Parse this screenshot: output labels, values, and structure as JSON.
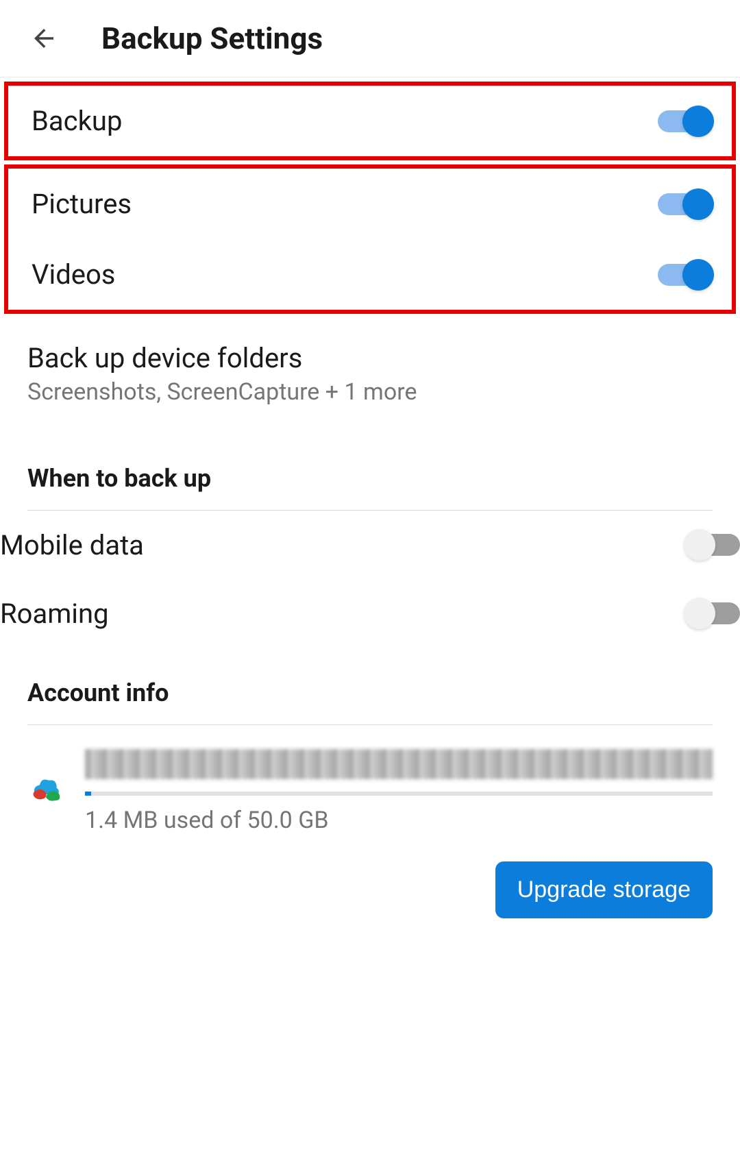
{
  "header": {
    "title": "Backup Settings"
  },
  "toggles": {
    "backup": {
      "label": "Backup",
      "on": true
    },
    "pictures": {
      "label": "Pictures",
      "on": true
    },
    "videos": {
      "label": "Videos",
      "on": true
    },
    "mobile_data": {
      "label": "Mobile data",
      "on": false
    },
    "roaming": {
      "label": "Roaming",
      "on": false
    }
  },
  "folders": {
    "title": "Back up device folders",
    "subtitle": "Screenshots, ScreenCapture + 1 more"
  },
  "sections": {
    "when": "When to back up",
    "account": "Account info"
  },
  "account": {
    "storage_text": "1.4 MB used of 50.0 GB",
    "upgrade_label": "Upgrade storage"
  }
}
